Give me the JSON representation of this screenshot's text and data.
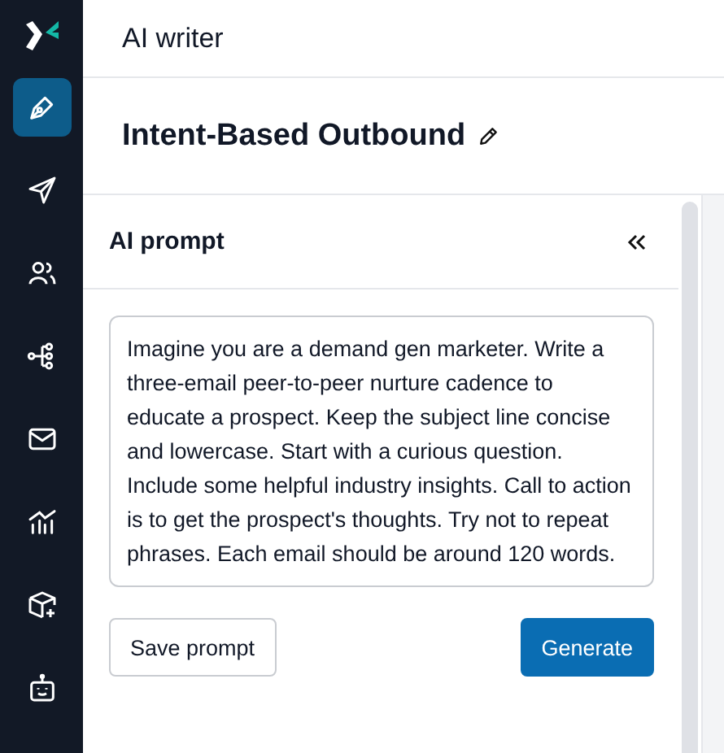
{
  "sidebar": {
    "items": [
      {
        "kind": "pen",
        "selected": true
      },
      {
        "kind": "send",
        "selected": false
      },
      {
        "kind": "users",
        "selected": false
      },
      {
        "kind": "flow",
        "selected": false
      },
      {
        "kind": "mail",
        "selected": false
      },
      {
        "kind": "chart",
        "selected": false
      },
      {
        "kind": "box",
        "selected": false
      },
      {
        "kind": "bot",
        "selected": false
      }
    ]
  },
  "header": {
    "title": "AI writer"
  },
  "document": {
    "title": "Intent-Based Outbound"
  },
  "panel": {
    "title": "AI prompt",
    "prompt": "Imagine you are a demand gen marketer. Write a three-email peer-to-peer nurture cadence to educate a prospect. Keep the subject line concise and lowercase. Start with a curious question. Include some helpful industry insights. Call to action is to get the prospect's thoughts. Try not to repeat phrases. Each email should be around 120 words.",
    "buttons": [
      {
        "label": "Save prompt",
        "kind": "secondary"
      },
      {
        "label": "Generate",
        "kind": "primary"
      }
    ]
  }
}
